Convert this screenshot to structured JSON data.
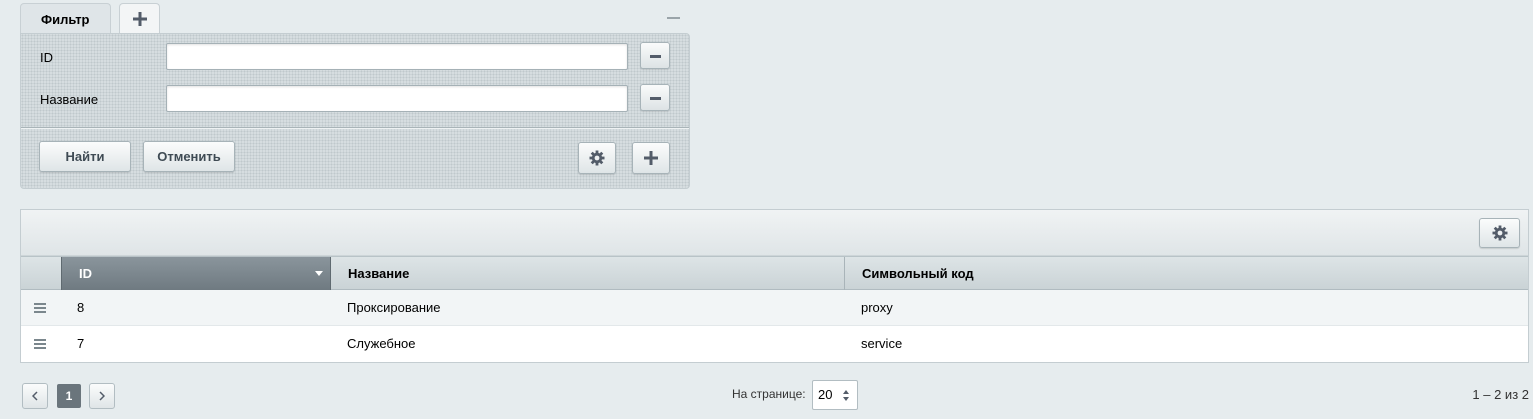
{
  "filter": {
    "tab_label": "Фильтр",
    "fields": [
      {
        "label": "ID",
        "value": ""
      },
      {
        "label": "Название",
        "value": ""
      }
    ],
    "find_button": "Найти",
    "cancel_button": "Отменить"
  },
  "table": {
    "columns": [
      "ID",
      "Название",
      "Символьный код"
    ],
    "sorted_column": "ID",
    "sort_direction": "desc",
    "rows": [
      {
        "id": "8",
        "name": "Проксирование",
        "code": "proxy"
      },
      {
        "id": "7",
        "name": "Служебное",
        "code": "service"
      }
    ]
  },
  "pagination": {
    "current_page": "1",
    "per_page_label": "На странице:",
    "per_page_value": "20",
    "counter": "1 – 2 из 2"
  },
  "icons": {
    "add": "plus-icon",
    "settings": "gear-icon",
    "remove": "minus-icon",
    "row_menu": "menu-icon",
    "prev": "chevron-left-icon",
    "next": "chevron-right-icon"
  },
  "colors": {
    "background": "#e6ecee",
    "filter_panel": "#d6dde0",
    "sorted_header": "#7b868d",
    "current_page": "#6a757c"
  }
}
